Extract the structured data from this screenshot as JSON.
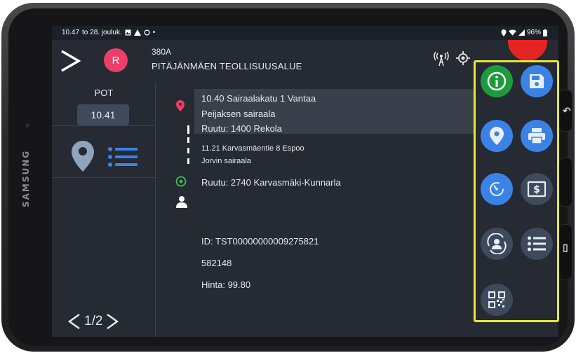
{
  "device": {
    "brand": "SAMSUNG"
  },
  "status_bar": {
    "time": "10.47",
    "date": "to 28. jouluk.",
    "battery": "96%"
  },
  "header": {
    "route_id": "380A",
    "route_name": "PITÄJÄNMÄEN TEOLLISUUSALUE",
    "avatar_letter": "R"
  },
  "left_panel": {
    "pot_label": "POT",
    "pot_time": "10.41",
    "pager": "1/2"
  },
  "stops": [
    {
      "line1": "10.40 Sairaalakatu 1 Vantaa",
      "line2": "Peijaksen sairaala",
      "line3": "Ruutu: 1400 Rekola"
    },
    {
      "line1": "11.21 Karvasmäentie 8 Espoo",
      "line2": "Jorvin sairaala"
    },
    {
      "line1": "Ruutu: 2740 Karvasmäki-Kunnarla"
    }
  ],
  "details": {
    "id": "ID: TST00000000009275821",
    "number": "582148",
    "price": "Hinta: 99.80"
  },
  "colors": {
    "accent_blue": "#3b82e6",
    "info_green": "#1e9b3c",
    "avatar_pink": "#ea3f68",
    "highlight_border": "#e5e83a",
    "stop_pin": "#ec3d6b",
    "stop_target": "#3cc35a"
  },
  "action_buttons": [
    "info-icon",
    "save-icon",
    "map-pin-icon",
    "print-icon",
    "timer-icon",
    "receipt-icon",
    "person-switch-icon",
    "list-icon",
    "qr-code-icon"
  ]
}
